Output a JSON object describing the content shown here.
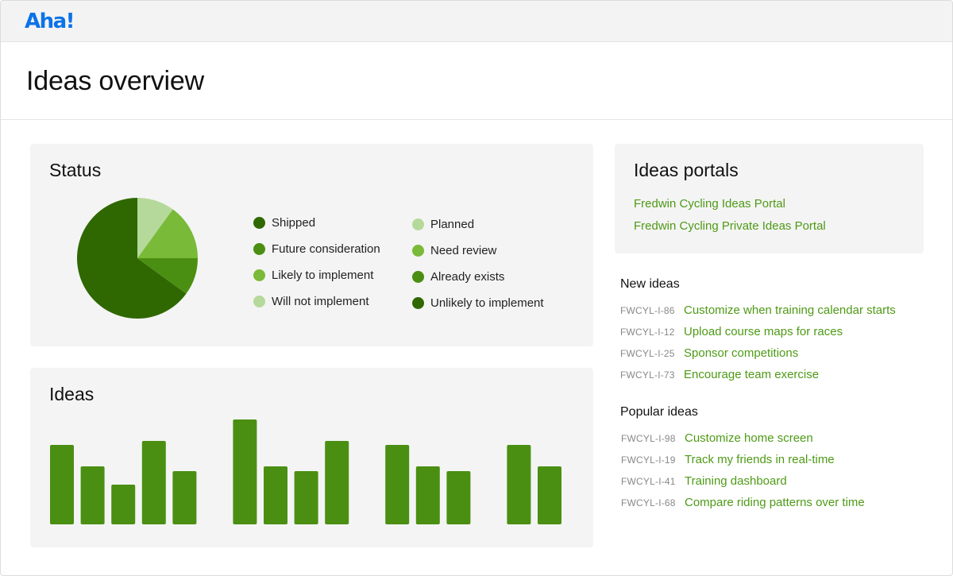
{
  "app": {
    "logo_text": "Aha!",
    "brand_color": "#0b73e8",
    "link_color": "#4e9a16"
  },
  "page": {
    "title": "Ideas overview"
  },
  "status_card": {
    "title": "Status",
    "legend": [
      {
        "label": "Shipped",
        "color": "#2f6800"
      },
      {
        "label": "Future consideration",
        "color": "#4a8f12"
      },
      {
        "label": "Likely to implement",
        "color": "#79ba38"
      },
      {
        "label": "Will not implement",
        "color": "#b5d99a"
      },
      {
        "label": "Planned",
        "color": "#b5d99a"
      },
      {
        "label": "Need review",
        "color": "#79ba38"
      },
      {
        "label": "Already exists",
        "color": "#4a8f12"
      },
      {
        "label": "Unlikely to implement",
        "color": "#2f6800"
      }
    ]
  },
  "ideas_card": {
    "title": "Ideas"
  },
  "chart_data": [
    {
      "type": "pie",
      "title": "Status",
      "slices": [
        {
          "label": "Dark green",
          "value": 65,
          "color": "#2f6800"
        },
        {
          "label": "Light green",
          "value": 10,
          "color": "#b5d99a"
        },
        {
          "label": "Medium-light green",
          "value": 15,
          "color": "#79ba38"
        },
        {
          "label": "Medium green",
          "value": 10,
          "color": "#4a8f12"
        }
      ]
    },
    {
      "type": "bar",
      "title": "Ideas",
      "color": "#4a8f12",
      "groups": [
        {
          "values": [
            100,
            73,
            50,
            105,
            67
          ]
        },
        {
          "values": [
            132,
            73,
            67,
            105
          ]
        },
        {
          "values": [
            100,
            73,
            67
          ]
        },
        {
          "values": [
            100,
            73
          ]
        }
      ],
      "ylim": [
        0,
        140
      ]
    }
  ],
  "portals": {
    "title": "Ideas portals",
    "links": [
      "Fredwin Cycling Ideas Portal",
      "Fredwin Cycling Private Ideas Portal"
    ]
  },
  "new_ideas": {
    "title": "New ideas",
    "items": [
      {
        "id": "FWCYL-I-86",
        "title": "Customize when training calendar starts"
      },
      {
        "id": "FWCYL-I-12",
        "title": "Upload course maps for races"
      },
      {
        "id": "FWCYL-I-25",
        "title": "Sponsor competitions"
      },
      {
        "id": "FWCYL-I-73",
        "title": "Encourage team exercise"
      }
    ]
  },
  "popular_ideas": {
    "title": "Popular ideas",
    "items": [
      {
        "id": "FWCYL-I-98",
        "title": "Customize home screen"
      },
      {
        "id": "FWCYL-I-19",
        "title": "Track my friends in real-time"
      },
      {
        "id": "FWCYL-I-41",
        "title": "Training dashboard"
      },
      {
        "id": "FWCYL-I-68",
        "title": "Compare riding patterns over time"
      }
    ]
  }
}
